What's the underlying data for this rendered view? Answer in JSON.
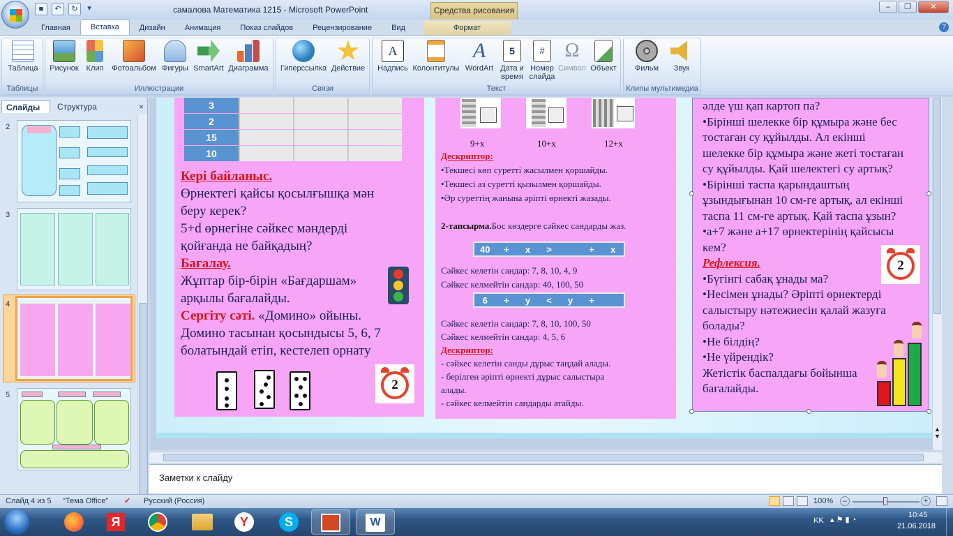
{
  "window": {
    "title": "самалова Математика 1215 - Microsoft PowerPoint",
    "context_tool": "Средства рисования"
  },
  "tabs": [
    "Главная",
    "Вставка",
    "Дизайн",
    "Анимация",
    "Показ слайдов",
    "Рецензирование",
    "Вид",
    "Формат"
  ],
  "active_tab": "Вставка",
  "ribbon": {
    "groups": {
      "tables": "Таблицы",
      "illustrations": "Иллюстрации",
      "links": "Связи",
      "text": "Текст",
      "media": "Клипы мультимедиа"
    },
    "buttons": {
      "table": "Таблица",
      "picture": "Рисунок",
      "clip": "Клип",
      "album": "Фотоальбом",
      "shapes": "Фигуры",
      "smartart": "SmartArt",
      "chart": "Диаграмма",
      "hyperlink": "Гиперссылка",
      "action": "Действие",
      "textbox": "Надпись",
      "header": "Колонтитулы",
      "wordart": "WordArt",
      "date1": "Дата и",
      "date2": "время",
      "slidenum1": "Номер",
      "slidenum2": "слайда",
      "symbol": "Символ",
      "object": "Объект",
      "movie": "Фильм",
      "sound": "Звук"
    }
  },
  "panel": {
    "tab_slides": "Слайды",
    "tab_outline": "Структура",
    "slides": [
      "2",
      "3",
      "4",
      "5"
    ],
    "selected": "4"
  },
  "slide": {
    "col1": {
      "table_numbers": [
        "3",
        "2",
        "15",
        "10"
      ],
      "feedback_title": "Кері байланыс.",
      "feedback_text1": "Өрнектегі қайсы қосылғышқа мән",
      "feedback_text2": "беру керек?",
      "feedback_text3": "5+d өрнегіне сәйкес мәндерді",
      "feedback_text4": "қойғанда не байқадың?",
      "assess_title": "Бағалау.",
      "assess_text1": "Жұптар бір-бірін «Бағдаршам»",
      "assess_text2": "арқылы бағалайды.",
      "break_title": "Сергіту сәті.",
      "break_text1": " «Домино» ойыны.",
      "break_text2": "Домино тасынан қосындысы 5, 6, 7",
      "break_text3": "болатындай етіп, кестелеп орнату",
      "clock_num": "2"
    },
    "col2": {
      "cube_labels": [
        "9+x",
        "10+x",
        "12+x"
      ],
      "desc_title": "Дескриптор:",
      "desc1": "•Текшесі көп суретті жасылмен қоршайды.",
      "desc2": "•Текшесі аз суретті қызылмен қоршайды.",
      "desc3": "•Әр суреттің жанына әріпті өрнекті жазады.",
      "task_title": "2-тапсырма.",
      "task_text": "Бос көздерге сәйкес сандарды жаз.",
      "eq1": [
        "40",
        "+",
        "x",
        ">",
        "",
        "+",
        "x"
      ],
      "fit1": "Сәйкес келетін сандар: 7, 8, 10, 4, 9",
      "nofit1": "Сәйкес келмейтін сандар: 40, 100, 50",
      "eq2": [
        "6",
        "+",
        "y",
        "<",
        "y",
        "+",
        ""
      ],
      "fit2": "Сәйкес келетін сандар: 7, 8, 10, 100, 50",
      "nofit2": "Сәйкес келмейтін сандар: 4, 5, 6",
      "desc_title2": "Дескриптор:",
      "d2_1": "- сәйкес келетін санды дұрыс таңдай алады.",
      "d2_2": "- берілген әріпті өрнекті дұрыс салыстыра",
      "d2_3": "алады.",
      "d2_4": "- сәйкес келмейтін сандарды атайды."
    },
    "col3": {
      "l1": "әлде үш қап картоп па?",
      "l2": "•Бірінші шелекке бір құмыра және бес",
      "l3": "тостаған су құйылды. Ал екінші",
      "l4": "шелекке бір құмыра және жеті тостаған",
      "l5": "су құйылды. Қай шелектегі су артық?",
      "l6": "•Бірінші таспа қарындаштың",
      "l7": "ұзындығынан 10 см-ге артық, ал екінші",
      "l8": "таспа 11 см-ге артық. Қай таспа ұзын?",
      "l9": "•a+7 және a+17 өрнектерінің қайсысы",
      "l10": "кем?",
      "refl": "Рефлексия.",
      "r1": "•Бүгінгі сабақ ұнады ма?",
      "r2": "•Несімен ұнады? Әріпті өрнектерді",
      "r3": "салыстыру нәтежиесін қалай жазуға",
      "r4": "болады?",
      "r5": "•Не білдің?",
      "r6": "•Не үйрендік?",
      "r7": "Жетістік баспалдағы бойынша",
      "r8": "бағалайды.",
      "clock_num": "2"
    }
  },
  "notes_placeholder": "Заметки к слайду",
  "status": {
    "slide": "Слайд 4 из 5",
    "theme": "\"Тема Office\"",
    "lang": "Русский (Россия)",
    "zoom": "100%"
  },
  "tray": {
    "lang": "KK",
    "time": "10:45",
    "date": "21.06.2018"
  },
  "colors": {
    "pink": "#f7a6f7",
    "blue_cell": "#5a93d1",
    "red_heading": "#d8151a"
  }
}
